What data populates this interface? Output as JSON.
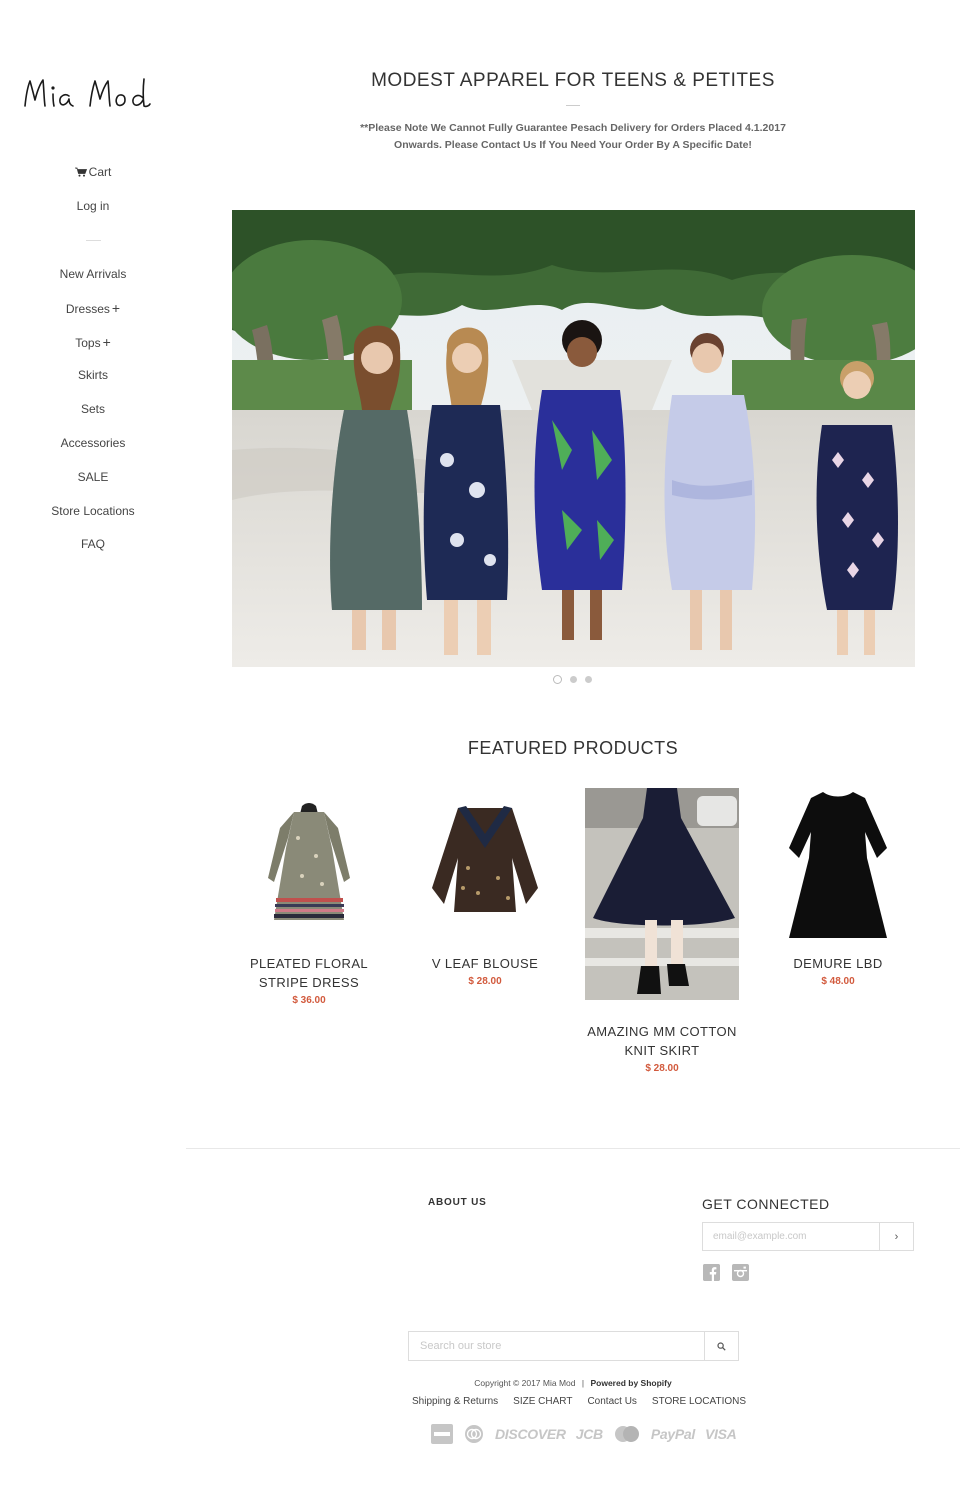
{
  "sidebar": {
    "logo_text": "Mia Mod",
    "cart_label": "Cart",
    "login_label": "Log in",
    "nav": [
      {
        "label": "New Arrivals",
        "has_children": false
      },
      {
        "label": "Dresses",
        "has_children": true
      },
      {
        "label": "Tops",
        "has_children": true
      },
      {
        "label": "Skirts",
        "has_children": false
      },
      {
        "label": "Sets",
        "has_children": false
      },
      {
        "label": "Accessories",
        "has_children": false
      },
      {
        "label": "SALE",
        "has_children": false
      },
      {
        "label": "Store Locations",
        "has_children": false
      },
      {
        "label": "FAQ",
        "has_children": false
      }
    ],
    "plus_glyph": "+"
  },
  "header": {
    "title": "MODEST APPAREL FOR TEENS & PETITES",
    "notice_line1": "**Please Note We Cannot Fully Guarantee Pesach Delivery for Orders Placed 4.1.2017",
    "notice_line2": "Onwards.  Please Contact Us If You Need Your Order By A Specific Date!"
  },
  "slideshow": {
    "slide_count": 3,
    "active_index": 0
  },
  "featured": {
    "title": "FEATURED PRODUCTS",
    "products": [
      {
        "name": "PLEATED FLORAL STRIPE DRESS",
        "price": "$ 36.00"
      },
      {
        "name": "V LEAF BLOUSE",
        "price": "$ 28.00"
      },
      {
        "name": "AMAZING MM COTTON KNIT SKIRT",
        "price": "$ 28.00"
      },
      {
        "name": "DEMURE LBD",
        "price": "$ 48.00"
      }
    ]
  },
  "footer": {
    "about_heading": "ABOUT US",
    "connect_heading": "GET CONNECTED",
    "email_placeholder": "email@example.com",
    "email_submit": "›",
    "social_icons": [
      "facebook-icon",
      "instagram-icon"
    ],
    "search_placeholder": "Search our store",
    "copyright": "Copyright © 2017 Mia Mod",
    "separator": "|",
    "powered_by": "Powered by Shopify",
    "links": [
      "Shipping & Returns",
      "SIZE CHART",
      "Contact Us",
      "STORE LOCATIONS"
    ],
    "payment_methods": [
      "american-express",
      "diners-club",
      "DISCOVER",
      "JCB",
      "master",
      "PayPal",
      "VISA"
    ]
  },
  "colors": {
    "price": "#d25a3d",
    "text": "#333333",
    "muted_icon": "#c6c6c6"
  }
}
